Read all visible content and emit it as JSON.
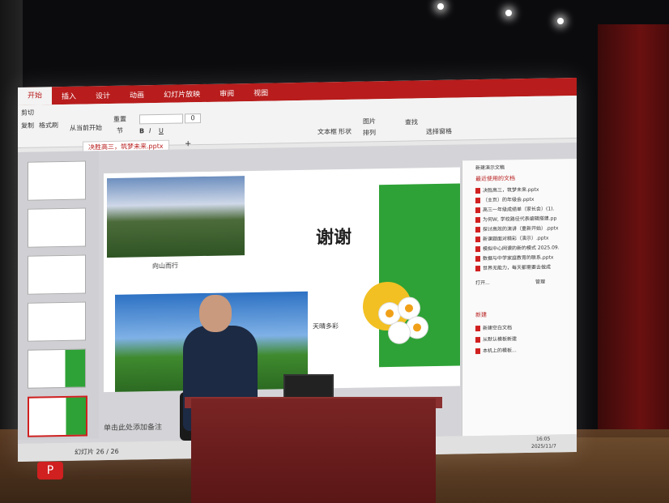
{
  "ribbon": {
    "tabs": [
      "开始",
      "插入",
      "设计",
      "动画",
      "幻灯片放映",
      "审阅",
      "视图"
    ],
    "start_from_current": "从当前开始",
    "reset": "重置",
    "section": "节",
    "font_size": "0",
    "text_box": "文本框",
    "shape": "形状",
    "picture": "图片",
    "arrange": "排列",
    "find": "查找",
    "select": "选择窗格",
    "copy": "复制",
    "format_painter": "格式刷",
    "cut": "剪切"
  },
  "document": {
    "tab_label": "决胜高三，筑梦未来.pptx",
    "new_tab": "+"
  },
  "slide": {
    "title": "谢谢",
    "caption_mountain": "向山而行",
    "caption_rainbow": "天晴多彩"
  },
  "notes_placeholder": "单击此处添加备注",
  "status": {
    "slide_counter": "幻灯片 26 / 26",
    "time": "16:05",
    "date": "2025/11/7"
  },
  "panel": {
    "header": "新建演示文稿",
    "recent_title": "最近使用的文档",
    "recent_files": [
      "决胜高三，筑梦未来.pptx",
      "（主页）的年级会.pptx",
      "高三一年级成绩单（家长会）(1).",
      "为何W, 学校路径代表编辑搭建.pp",
      "探讨高效的演讲（重新开始）.pptx",
      "新课题面对精彩（演示）.pptx",
      "模拟中心网课的新的模式 2025.09.",
      "数据与中学家庭教育的联系.pptx",
      "世界无能力，每天都需要去做成"
    ],
    "open_label": "打开...",
    "manage_label": "管理",
    "new_title": "新建",
    "new_items": [
      "新建空白文档",
      "从默认模板新建",
      "本机上的模板..."
    ]
  },
  "colors": {
    "accent": "#b81c1c",
    "slide_green": "#2ea236",
    "flower_yellow": "#f2c022"
  }
}
